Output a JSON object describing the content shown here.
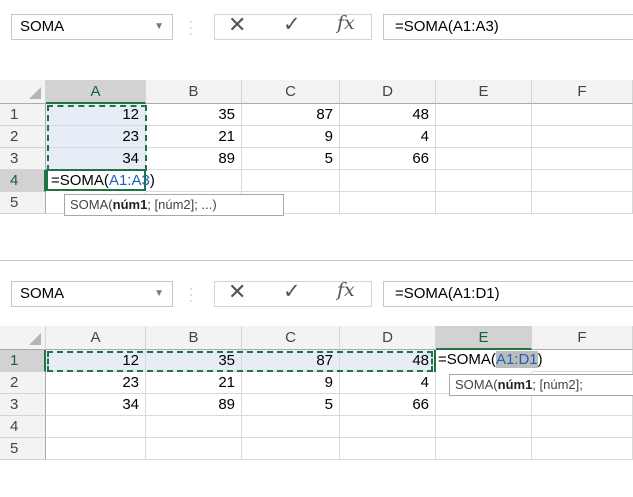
{
  "top": {
    "name_box": "SOMA",
    "formula": "=SOMA(A1:A3)",
    "columns": [
      "A",
      "B",
      "C",
      "D",
      "E",
      "F"
    ],
    "rows": [
      "1",
      "2",
      "3",
      "4",
      "5"
    ],
    "cells": [
      [
        "12",
        "35",
        "87",
        "48"
      ],
      [
        "23",
        "21",
        "9",
        "4"
      ],
      [
        "34",
        "89",
        "5",
        "66"
      ]
    ],
    "edit_prefix": "=SOMA(",
    "edit_ref": "A1:A3",
    "edit_suffix": ")",
    "tooltip_prefix": "SOMA(",
    "tooltip_bold": "núm1",
    "tooltip_suffix": "; [núm2]; ...)"
  },
  "bottom": {
    "name_box": "SOMA",
    "formula": "=SOMA(A1:D1)",
    "columns": [
      "A",
      "B",
      "C",
      "D",
      "E",
      "F"
    ],
    "rows": [
      "1",
      "2",
      "3",
      "4",
      "5"
    ],
    "cells": [
      [
        "12",
        "35",
        "87",
        "48"
      ],
      [
        "23",
        "21",
        "9",
        "4"
      ],
      [
        "34",
        "89",
        "5",
        "66"
      ]
    ],
    "edit_prefix": "=SOMA(",
    "edit_ref": "A1:D1",
    "edit_suffix": ")",
    "tooltip_prefix": "SOMA(",
    "tooltip_bold": "núm1",
    "tooltip_suffix": "; [núm2];"
  },
  "colors": {
    "excel_green": "#217346",
    "reference_blue": "#1f5fc0",
    "range_fill": "#e6edf7"
  },
  "icons": [
    "chevron-down-icon",
    "cancel-icon",
    "enter-check-icon",
    "insert-function-icon"
  ]
}
